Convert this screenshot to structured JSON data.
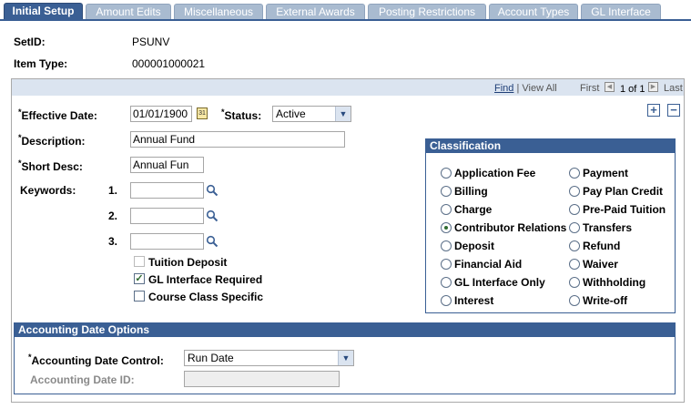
{
  "tabs": [
    {
      "label": "Initial Setup",
      "active": true
    },
    {
      "label": "Amount Edits"
    },
    {
      "label": "Miscellaneous"
    },
    {
      "label": "External Awards"
    },
    {
      "label": "Posting Restrictions"
    },
    {
      "label": "Account Types"
    },
    {
      "label": "GL Interface"
    }
  ],
  "header": {
    "setid_label": "SetID:",
    "setid_value": "PSUNV",
    "itemtype_label": "Item Type:",
    "itemtype_value": "000001000021"
  },
  "nav": {
    "find": "Find",
    "view_all": "View All",
    "first": "First",
    "count": "1 of 1",
    "last": "Last"
  },
  "form": {
    "effdate_label": "Effective Date:",
    "effdate_value": "01/01/1900",
    "status_label": "Status:",
    "status_value": "Active",
    "desc_label": "Description:",
    "desc_value": "Annual Fund",
    "shortdesc_label": "Short Desc:",
    "shortdesc_value": "Annual Fun",
    "keywords_label": "Keywords:",
    "kw1": "1.",
    "kw2": "2.",
    "kw3": "3.",
    "tuition_deposit": "Tuition Deposit",
    "gl_interface_required": "GL Interface Required",
    "course_class_specific": "Course Class Specific"
  },
  "classification": {
    "title": "Classification",
    "left": [
      "Application Fee",
      "Billing",
      "Charge",
      "Contributor Relations",
      "Deposit",
      "Financial Aid",
      "GL Interface Only",
      "Interest"
    ],
    "right": [
      "Payment",
      "Pay Plan Credit",
      "Pre-Paid Tuition",
      "Transfers",
      "Refund",
      "Waiver",
      "Withholding",
      "Write-off"
    ],
    "selected": "Contributor Relations"
  },
  "accounting": {
    "title": "Accounting Date Options",
    "control_label": "Accounting Date Control:",
    "control_value": "Run Date",
    "id_label": "Accounting Date ID:",
    "id_value": ""
  },
  "colors": {
    "accent": "#3a5f94",
    "tab_inactive": "#a9bbd0"
  }
}
